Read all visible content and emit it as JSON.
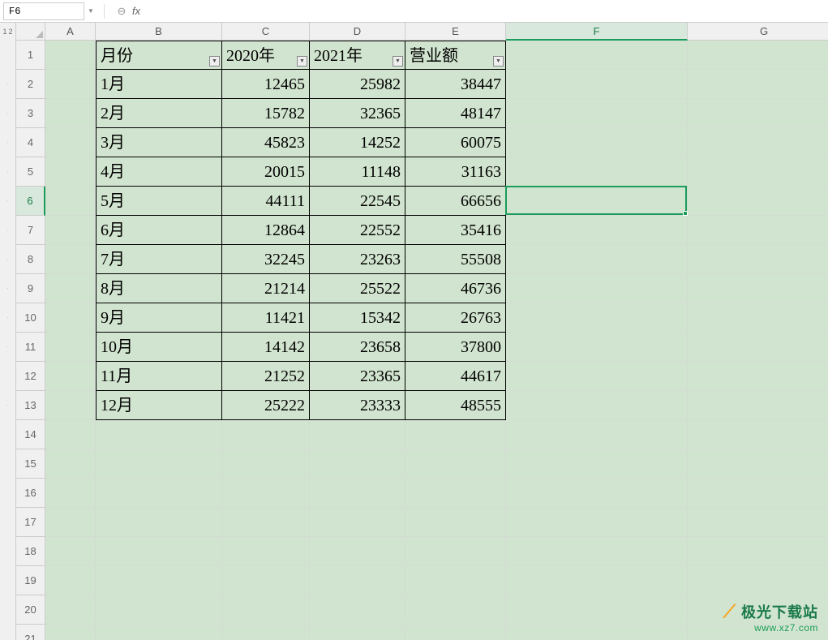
{
  "cell_reference": "F6",
  "fx_label": "fx",
  "formula_value": "",
  "outline_levels": [
    "1",
    "2"
  ],
  "columns": [
    {
      "letter": "A",
      "widthClass": "w-A"
    },
    {
      "letter": "B",
      "widthClass": "w-B"
    },
    {
      "letter": "C",
      "widthClass": "w-C"
    },
    {
      "letter": "D",
      "widthClass": "w-D"
    },
    {
      "letter": "E",
      "widthClass": "w-E"
    },
    {
      "letter": "F",
      "widthClass": "w-F",
      "active": true
    },
    {
      "letter": "G",
      "widthClass": "w-G"
    }
  ],
  "row_count": 21,
  "active_row": 6,
  "active_col": "F",
  "table": {
    "start_row": 1,
    "start_col": "B",
    "headers": [
      "月份",
      "2020年",
      "2021年",
      "营业额"
    ],
    "rows": [
      [
        "1月",
        "12465",
        "25982",
        "38447"
      ],
      [
        "2月",
        "15782",
        "32365",
        "48147"
      ],
      [
        "3月",
        "45823",
        "14252",
        "60075"
      ],
      [
        "4月",
        "20015",
        "11148",
        "31163"
      ],
      [
        "5月",
        "44111",
        "22545",
        "66656"
      ],
      [
        "6月",
        "12864",
        "22552",
        "35416"
      ],
      [
        "7月",
        "32245",
        "23263",
        "55508"
      ],
      [
        "8月",
        "21214",
        "25522",
        "46736"
      ],
      [
        "9月",
        "11421",
        "15342",
        "26763"
      ],
      [
        "10月",
        "14142",
        "23658",
        "37800"
      ],
      [
        "11月",
        "21252",
        "23365",
        "44617"
      ],
      [
        "12月",
        "25222",
        "23333",
        "48555"
      ]
    ]
  },
  "watermark": {
    "text": "极光下载站",
    "url": "www.xz7.com"
  },
  "chart_data": {
    "type": "table",
    "title": "",
    "columns": [
      "月份",
      "2020年",
      "2021年",
      "营业额"
    ],
    "rows": [
      {
        "月份": "1月",
        "2020年": 12465,
        "2021年": 25982,
        "营业额": 38447
      },
      {
        "月份": "2月",
        "2020年": 15782,
        "2021年": 32365,
        "营业额": 48147
      },
      {
        "月份": "3月",
        "2020年": 45823,
        "2021年": 14252,
        "营业额": 60075
      },
      {
        "月份": "4月",
        "2020年": 20015,
        "2021年": 11148,
        "营业额": 31163
      },
      {
        "月份": "5月",
        "2020年": 44111,
        "2021年": 22545,
        "营业额": 66656
      },
      {
        "月份": "6月",
        "2020年": 12864,
        "2021年": 22552,
        "营业额": 35416
      },
      {
        "月份": "7月",
        "2020年": 32245,
        "2021年": 23263,
        "营业额": 55508
      },
      {
        "月份": "8月",
        "2020年": 21214,
        "2021年": 25522,
        "营业额": 46736
      },
      {
        "月份": "9月",
        "2020年": 11421,
        "2021年": 15342,
        "营业额": 26763
      },
      {
        "月份": "10月",
        "2020年": 14142,
        "2021年": 23658,
        "营业额": 37800
      },
      {
        "月份": "11月",
        "2020年": 21252,
        "2021年": 23365,
        "营业额": 44617
      },
      {
        "月份": "12月",
        "2020年": 25222,
        "2021年": 23333,
        "营业额": 48555
      }
    ]
  }
}
